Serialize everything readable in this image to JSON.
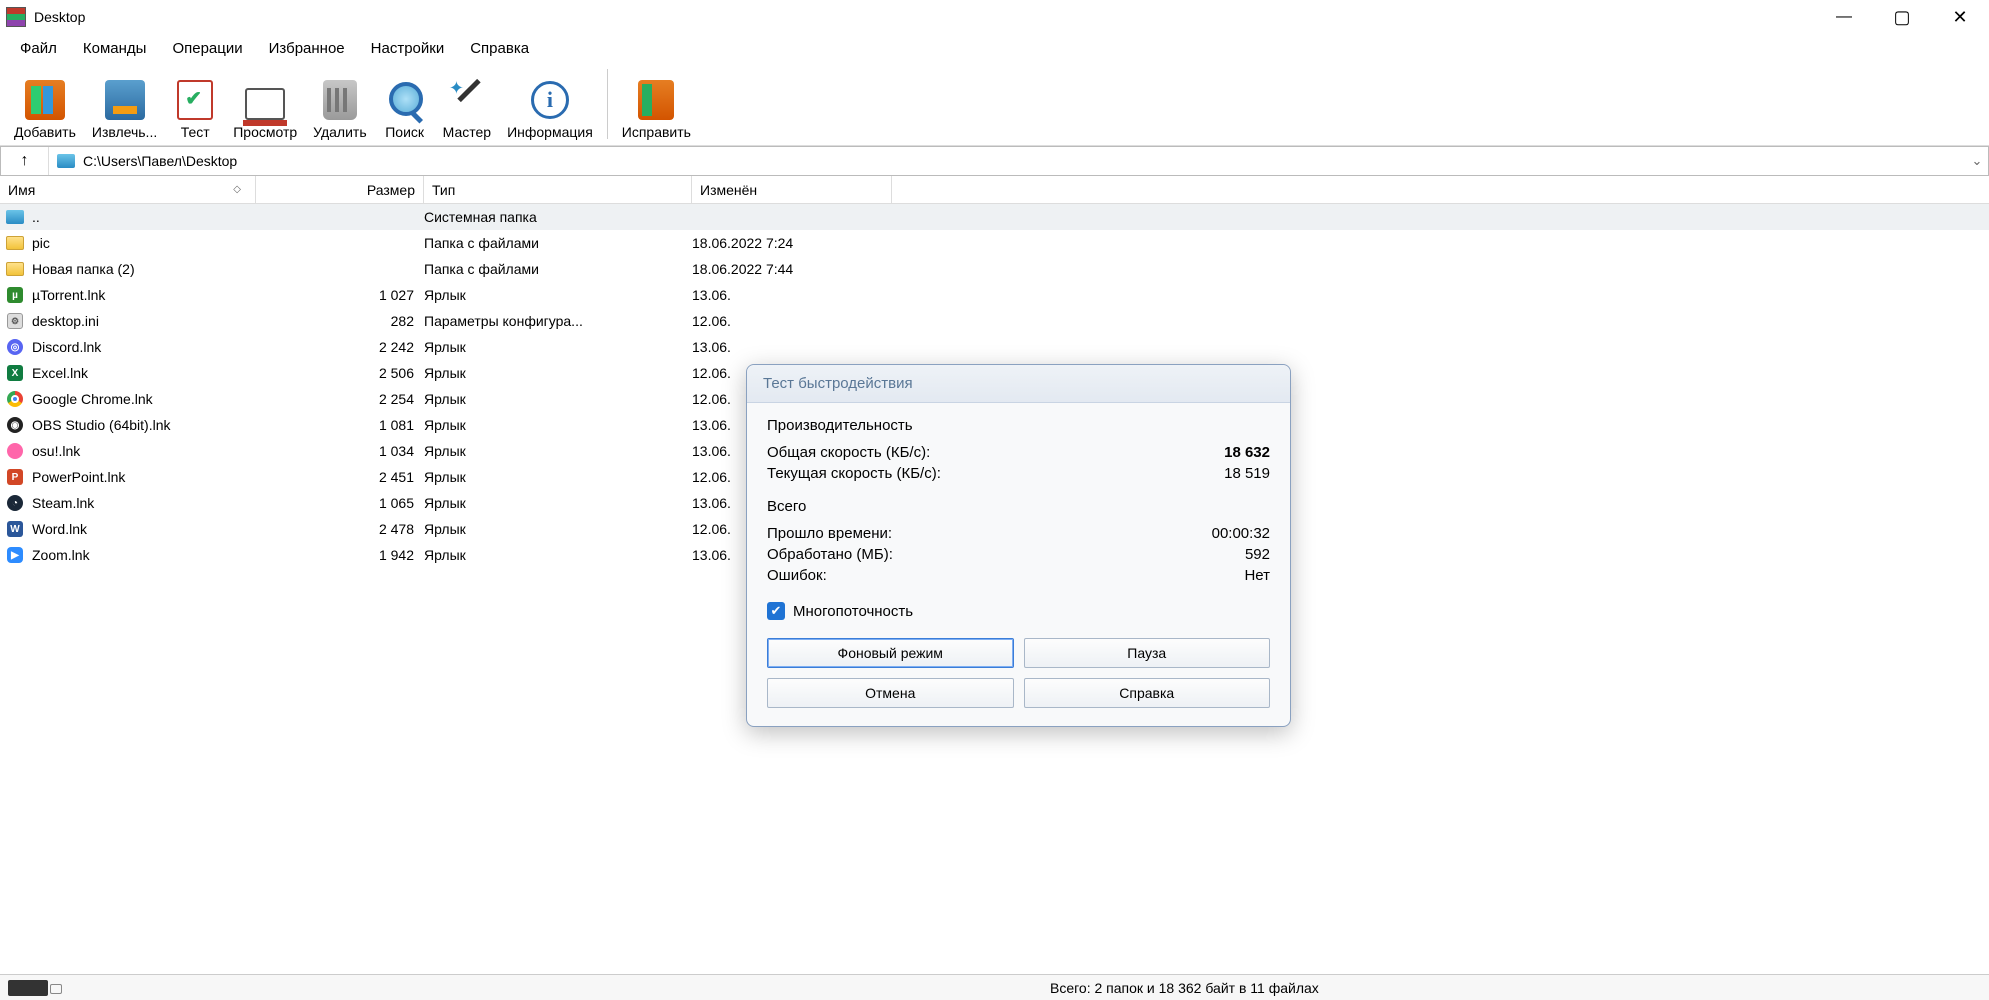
{
  "window": {
    "title": "Desktop"
  },
  "menus": [
    "Файл",
    "Команды",
    "Операции",
    "Избранное",
    "Настройки",
    "Справка"
  ],
  "toolbar": [
    {
      "id": "add",
      "label": "Добавить"
    },
    {
      "id": "extract",
      "label": "Извлечь..."
    },
    {
      "id": "test",
      "label": "Тест"
    },
    {
      "id": "view",
      "label": "Просмотр"
    },
    {
      "id": "delete",
      "label": "Удалить"
    },
    {
      "id": "find",
      "label": "Поиск"
    },
    {
      "id": "wizard",
      "label": "Мастер"
    },
    {
      "id": "info",
      "label": "Информация"
    },
    {
      "id": "repair",
      "label": "Исправить"
    }
  ],
  "path": "C:\\Users\\Павел\\Desktop",
  "columns": {
    "name": "Имя",
    "size": "Размер",
    "type": "Тип",
    "modified": "Изменён"
  },
  "files": [
    {
      "icon": "parent",
      "name": "..",
      "size": "",
      "type": "Системная папка",
      "modified": "",
      "selected": true
    },
    {
      "icon": "folder",
      "name": "pic",
      "size": "",
      "type": "Папка с файлами",
      "modified": "18.06.2022 7:24"
    },
    {
      "icon": "folder",
      "name": "Новая папка (2)",
      "size": "",
      "type": "Папка с файлами",
      "modified": "18.06.2022 7:44"
    },
    {
      "icon": "utorrent",
      "name": "µTorrent.lnk",
      "size": "1 027",
      "type": "Ярлык",
      "modified": "13.06."
    },
    {
      "icon": "ini",
      "name": "desktop.ini",
      "size": "282",
      "type": "Параметры конфигура...",
      "modified": "12.06."
    },
    {
      "icon": "discord",
      "name": "Discord.lnk",
      "size": "2 242",
      "type": "Ярлык",
      "modified": "13.06."
    },
    {
      "icon": "excel",
      "name": "Excel.lnk",
      "size": "2 506",
      "type": "Ярлык",
      "modified": "12.06."
    },
    {
      "icon": "chrome",
      "name": "Google Chrome.lnk",
      "size": "2 254",
      "type": "Ярлык",
      "modified": "12.06."
    },
    {
      "icon": "obs",
      "name": "OBS Studio (64bit).lnk",
      "size": "1 081",
      "type": "Ярлык",
      "modified": "13.06."
    },
    {
      "icon": "osu",
      "name": "osu!.lnk",
      "size": "1 034",
      "type": "Ярлык",
      "modified": "13.06."
    },
    {
      "icon": "ppt",
      "name": "PowerPoint.lnk",
      "size": "2 451",
      "type": "Ярлык",
      "modified": "12.06."
    },
    {
      "icon": "steam",
      "name": "Steam.lnk",
      "size": "1 065",
      "type": "Ярлык",
      "modified": "13.06."
    },
    {
      "icon": "word",
      "name": "Word.lnk",
      "size": "2 478",
      "type": "Ярлык",
      "modified": "12.06."
    },
    {
      "icon": "zoom",
      "name": "Zoom.lnk",
      "size": "1 942",
      "type": "Ярлык",
      "modified": "13.06."
    }
  ],
  "statusbar": {
    "text": "Всего: 2 папок и 18 362 байт в 11 файлах"
  },
  "dialog": {
    "title": "Тест быстродействия",
    "group1": "Производительность",
    "total_speed_label": "Общая скорость (КБ/с):",
    "total_speed_value": "18 632",
    "cur_speed_label": "Текущая скорость (КБ/с):",
    "cur_speed_value": "18 519",
    "group2": "Всего",
    "elapsed_label": "Прошло времени:",
    "elapsed_value": "00:00:32",
    "processed_label": "Обработано (МБ):",
    "processed_value": "592",
    "errors_label": "Ошибок:",
    "errors_value": "Нет",
    "multithread_label": "Многопоточность",
    "btn_background": "Фоновый режим",
    "btn_pause": "Пауза",
    "btn_cancel": "Отмена",
    "btn_help": "Справка"
  }
}
